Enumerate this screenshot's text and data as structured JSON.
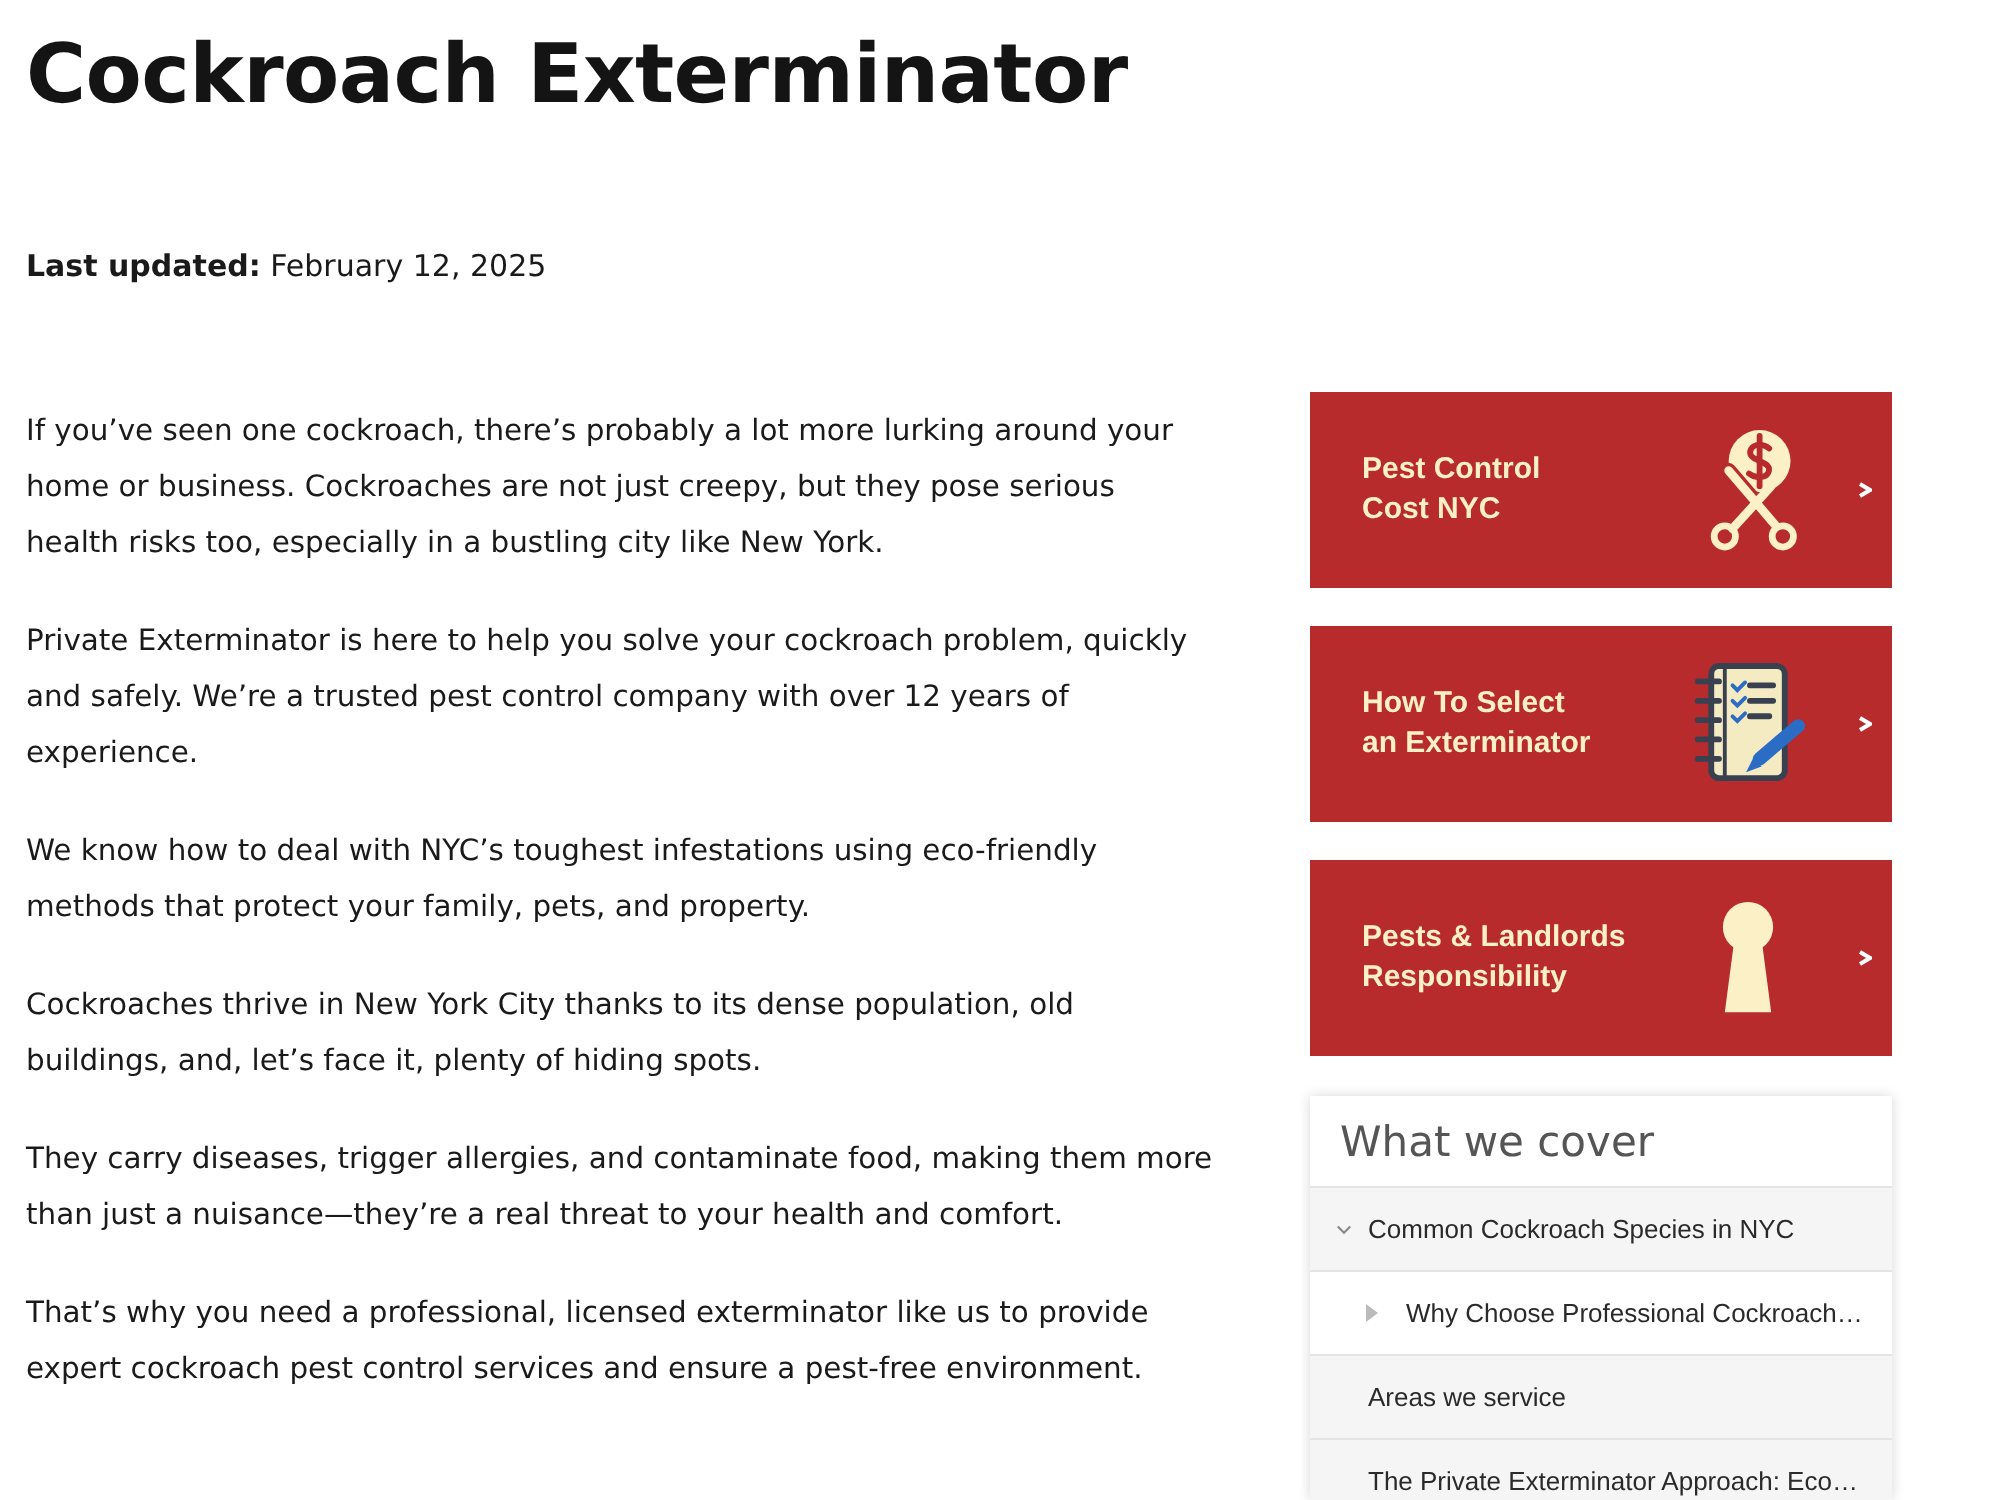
{
  "header": {
    "title": "Cockroach Exterminator",
    "updated": "**Last updated:** February 12, 2025"
  },
  "article": {
    "paragraphs": [
      "If you’ve seen one cockroach, there’s probably a lot more lurking around your home or business. Cockroaches are not just creepy, but they pose serious health risks too, especially in a bustling city like New York.",
      "Private Exterminator is here to help you solve your cockroach problem, quickly and safely. We’re a trusted pest control company with over 12 years of experience.",
      "We know how to deal with NYC’s toughest infestations using eco-friendly methods that protect your family, pets, and property.",
      "Cockroaches thrive in New York City thanks to its dense population, old buildings, and, let’s face it, plenty of hiding spots.",
      "They carry diseases, trigger allergies, and contaminate food, making them more than just a nuisance—they’re a real threat to your health and comfort.",
      "That’s why you need a professional, licensed exterminator like us to provide expert cockroach pest control services and ensure a pest-free environment."
    ]
  },
  "sidebar": {
    "cards": [
      {
        "title": "Pest Control\nCost NYC"
      },
      {
        "title": "How To Select\nan Exterminator"
      },
      {
        "title": "Pests & Landlords\nResponsibility"
      }
    ],
    "toc": {
      "title": "What we cover",
      "items": [
        {
          "label": "Common Cockroach Species in NYC",
          "kind": "branch",
          "expanded": true,
          "children": [
            {
              "label": "Why Choose Professional Cockroach…",
              "kind": "branch",
              "expanded": false
            }
          ]
        },
        {
          "label": "Areas we service",
          "kind": "leaf"
        },
        {
          "label": "The Private Exterminator Approach: Eco…",
          "kind": "leaf"
        }
      ]
    }
  }
}
